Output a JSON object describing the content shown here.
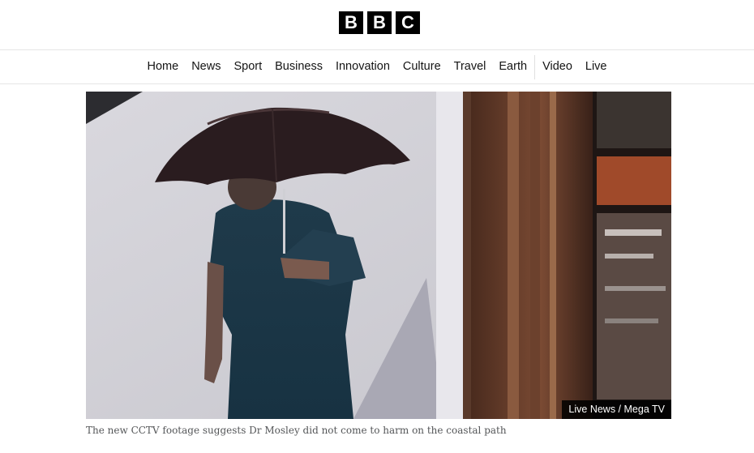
{
  "header": {
    "logo_letters": [
      "B",
      "B",
      "C"
    ]
  },
  "nav": {
    "items": [
      {
        "label": "Home"
      },
      {
        "label": "News"
      },
      {
        "label": "Sport"
      },
      {
        "label": "Business"
      },
      {
        "label": "Innovation"
      },
      {
        "label": "Culture"
      },
      {
        "label": "Travel"
      },
      {
        "label": "Earth"
      },
      {
        "label": "Video"
      },
      {
        "label": "Live"
      }
    ]
  },
  "figure": {
    "credit": "Live News / Mega TV",
    "caption": "The new CCTV footage suggests Dr Mosley did not come to harm on the coastal path"
  },
  "colors": {
    "logo_bg": "#000000",
    "text": "#141414",
    "caption": "#545658",
    "divider": "#e6e6e6"
  }
}
